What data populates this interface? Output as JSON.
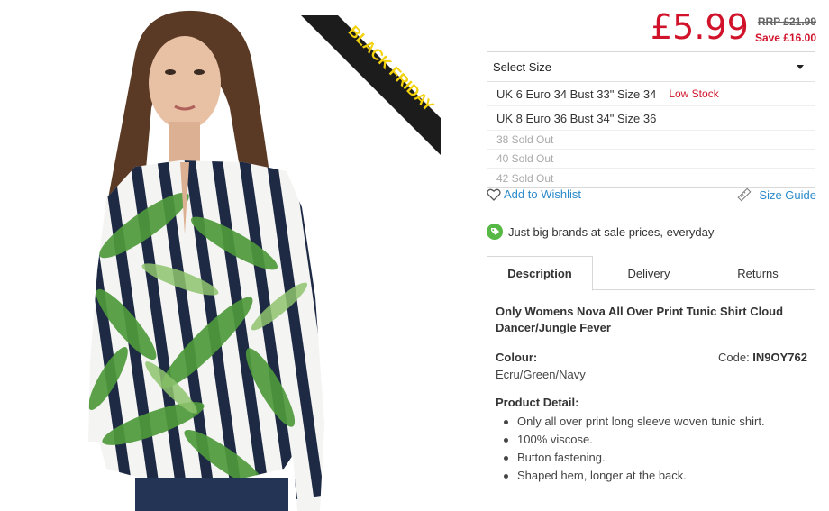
{
  "product": {
    "badge": "BLACK FRIDAY",
    "price": "£5.99",
    "rrp": "RRP £21.99",
    "save": "Save £16.00"
  },
  "size_selector": {
    "label": "Select Size",
    "options": [
      {
        "label": "UK 6 Euro 34 Bust 33\" Size 34",
        "stock": "Low Stock"
      },
      {
        "label": "UK 8 Euro 36 Bust 34\" Size 36",
        "stock": ""
      },
      {
        "label": "38 Sold Out",
        "stock": ""
      },
      {
        "label": "40 Sold Out",
        "stock": ""
      },
      {
        "label": "42 Sold Out",
        "stock": ""
      }
    ]
  },
  "actions": {
    "wishlist": "Add to Wishlist",
    "size_guide": "Size Guide"
  },
  "tagline": "Just big brands at sale prices, everyday",
  "tabs": [
    {
      "label": "Description",
      "active": true
    },
    {
      "label": "Delivery",
      "active": false
    },
    {
      "label": "Returns",
      "active": false
    }
  ],
  "description": {
    "title": "Only Womens Nova All Over Print Tunic Shirt Cloud Dancer/Jungle Fever",
    "colour_label": "Colour:",
    "colour_value": "Ecru/Green/Navy",
    "code_label": "Code:",
    "code_value": "IN9OY762",
    "detail_label": "Product Detail:",
    "details": [
      "Only all over print long sleeve woven tunic shirt.",
      "100% viscose.",
      "Button fastening.",
      "Shaped hem, longer at the back."
    ]
  },
  "colors": {
    "price_red": "#d0132a",
    "link_blue": "#2a8ac9",
    "brand_green": "#57b846",
    "ribbon_black": "#1c1c1c",
    "ribbon_yellow": "#f4d20b"
  }
}
